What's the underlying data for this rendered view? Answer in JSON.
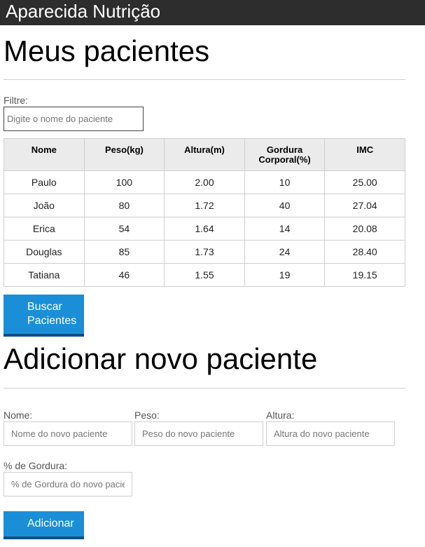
{
  "header": {
    "title": "Aparecida Nutrição"
  },
  "patients_section": {
    "title": "Meus pacientes",
    "filter_label": "Filtre:",
    "filter_placeholder": "Digite o nome do paciente",
    "columns": [
      "Nome",
      "Peso(kg)",
      "Altura(m)",
      "Gordura Corporal(%)",
      "IMC"
    ],
    "rows": [
      [
        "Paulo",
        "100",
        "2.00",
        "10",
        "25.00"
      ],
      [
        "João",
        "80",
        "1.72",
        "40",
        "27.04"
      ],
      [
        "Erica",
        "54",
        "1.64",
        "14",
        "20.08"
      ],
      [
        "Douglas",
        "85",
        "1.73",
        "24",
        "28.40"
      ],
      [
        "Tatiana",
        "46",
        "1.55",
        "19",
        "19.15"
      ]
    ],
    "search_button_line1": "Buscar",
    "search_button_line2": "Pacientes"
  },
  "add_section": {
    "title": "Adicionar novo paciente",
    "name_label": "Nome:",
    "name_placeholder": "Nome do novo paciente",
    "weight_label": "Peso:",
    "weight_placeholder": "Peso do novo paciente",
    "height_label": "Altura:",
    "height_placeholder": "Altura do novo paciente",
    "fat_label": "% de Gordura:",
    "fat_placeholder": "% de Gordura do novo paciente",
    "add_button": "Adicionar"
  },
  "colors": {
    "header_bg": "#2d2d2d",
    "button": "#1a8fd8",
    "button_border": "#0e4f86",
    "table_header_bg": "#ebebeb"
  }
}
